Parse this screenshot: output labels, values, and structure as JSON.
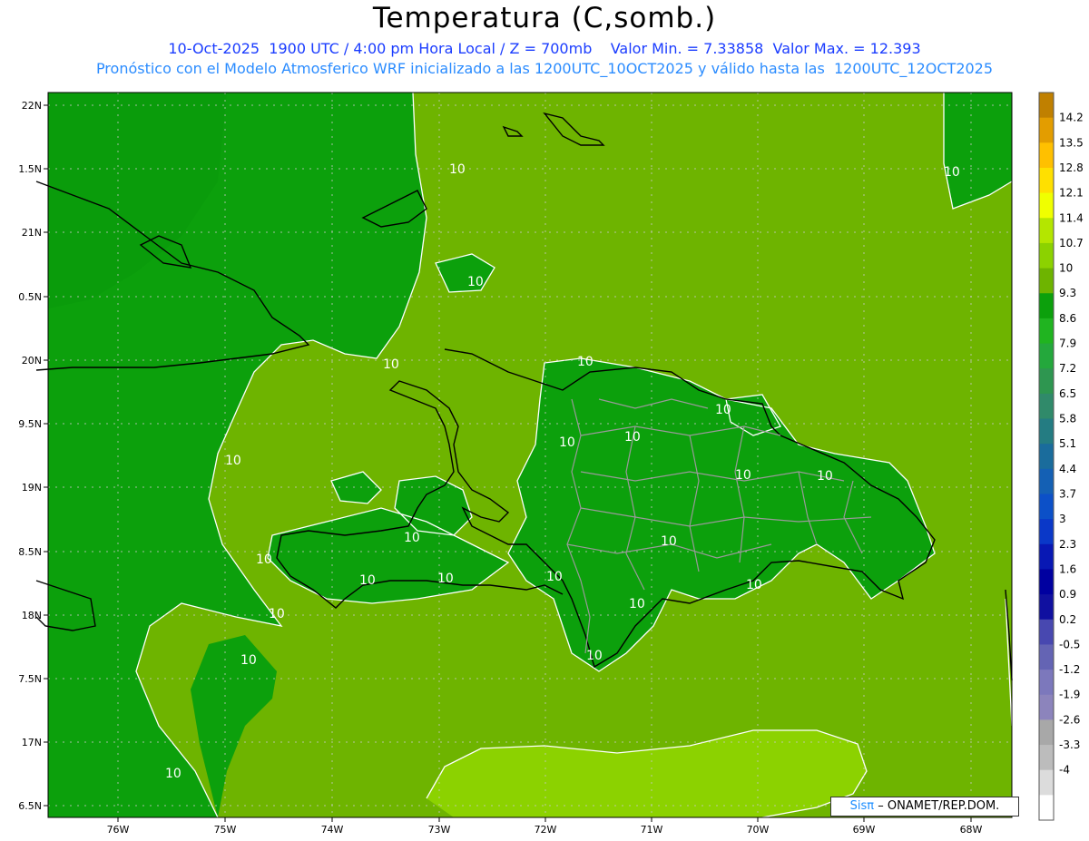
{
  "header": {
    "title": "Temperatura (C,somb.)",
    "line1": "10-Oct-2025  1900 UTC / 4:00 pm Hora Local / Z = 700mb    Valor Min. = 7.33858  Valor Max. = 12.393",
    "line2": "Pronóstico con el Modelo Atmosferico WRF inicializado a las 1200UTC_10OCT2025 y válido hasta las  1200UTC_12OCT2025"
  },
  "axes": {
    "lat_ticks": [
      "22N",
      "1.5N",
      "21N",
      "0.5N",
      "20N",
      "9.5N",
      "19N",
      "8.5N",
      "18N",
      "7.5N",
      "17N",
      "6.5N"
    ],
    "lon_ticks": [
      "76W",
      "75W",
      "74W",
      "73W",
      "72W",
      "71W",
      "70W",
      "69W",
      "68W"
    ]
  },
  "colorbar": {
    "labels": [
      "14.2",
      "13.5",
      "12.8",
      "12.1",
      "11.4",
      "10.7",
      "10",
      "9.3",
      "8.6",
      "7.9",
      "7.2",
      "6.5",
      "5.8",
      "5.1",
      "4.4",
      "3.7",
      "3",
      "2.3",
      "1.6",
      "0.9",
      "0.2",
      "-0.5",
      "-1.2",
      "-1.9",
      "-2.6",
      "-3.3",
      "-4"
    ],
    "colors": [
      "#c08000",
      "#e39d00",
      "#ffc000",
      "#ffe000",
      "#f0ff00",
      "#b4e600",
      "#8cd200",
      "#6eb400",
      "#0ca00c",
      "#20b420",
      "#24a83c",
      "#2e9650",
      "#308a6a",
      "#247c82",
      "#1a6c9c",
      "#1460b4",
      "#0c50c8",
      "#0a38c8",
      "#0818b4",
      "#0000a0",
      "#1010a0",
      "#4848b0",
      "#6464b4",
      "#7c78bc",
      "#8c84bc",
      "#a8a8a8",
      "#bcbcbc",
      "#dcdcdc",
      "#ffffff"
    ]
  },
  "contour_labels": [
    "10",
    "10",
    "10",
    "10",
    "10",
    "10",
    "10",
    "10",
    "10",
    "10",
    "10",
    "10",
    "10",
    "10",
    "10",
    "10",
    "10",
    "10",
    "10",
    "10",
    "10",
    "10",
    "10"
  ],
  "credit": {
    "brand": "Sisπ",
    "text": "– ONAMET/REP.DOM."
  }
}
